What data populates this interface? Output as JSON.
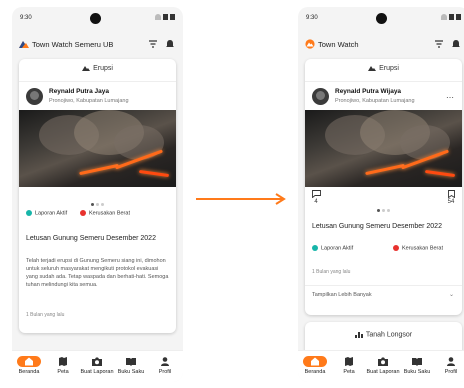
{
  "status": {
    "time": "9:30"
  },
  "colors": {
    "accent": "#ff7a1a",
    "active_badge": "#17b5a9",
    "severe_badge": "#e8322e"
  },
  "left": {
    "app_title": "Town Watch Semeru UB",
    "category": "Erupsi",
    "user_name": "Reynald Putra Jaya",
    "user_location": "Pronojiwo, Kabupatan Lumajang",
    "badge_active": "Laporan Aktif",
    "badge_severe": "Kerusakan Berat",
    "post_title": "Letusan Gunung Semeru Desember 2022",
    "post_body": "Telah terjadi erupsi di Gunung Semeru siang ini, dimohon untuk seluruh masyarakat mengikuti protokol evakuasi yang sudah ada. Tetap waspada dan berhati-hati. Semoga tuhan melindungi kita semua.",
    "post_time": "1 Bulan yang lalu"
  },
  "right": {
    "app_title": "Town Watch",
    "category": "Erupsi",
    "user_name": "Reynald Putra Wijaya",
    "user_location": "Pronojiwo, Kabupatan Lumajang",
    "comment_count": "4",
    "bookmark_count": "54",
    "badge_active": "Laporan Aktif",
    "badge_severe": "Kerusakan Berat",
    "post_title": "Letusan Gunung Semeru Desember 2022",
    "post_time": "1 Bulan yang lalu",
    "show_more": "Tampilkan Lebih Banyak",
    "next_category": "Tanah Longsor"
  },
  "nav": [
    "Beranda",
    "Peta",
    "Buat Laporan",
    "Buku Saku",
    "Profil"
  ],
  "icons": [
    "mountain-icon",
    "filter-icon",
    "bell-icon",
    "comment-icon",
    "bookmark-icon",
    "home-icon",
    "map-icon",
    "camera-icon",
    "book-icon",
    "person-icon",
    "arrow-right-icon"
  ]
}
